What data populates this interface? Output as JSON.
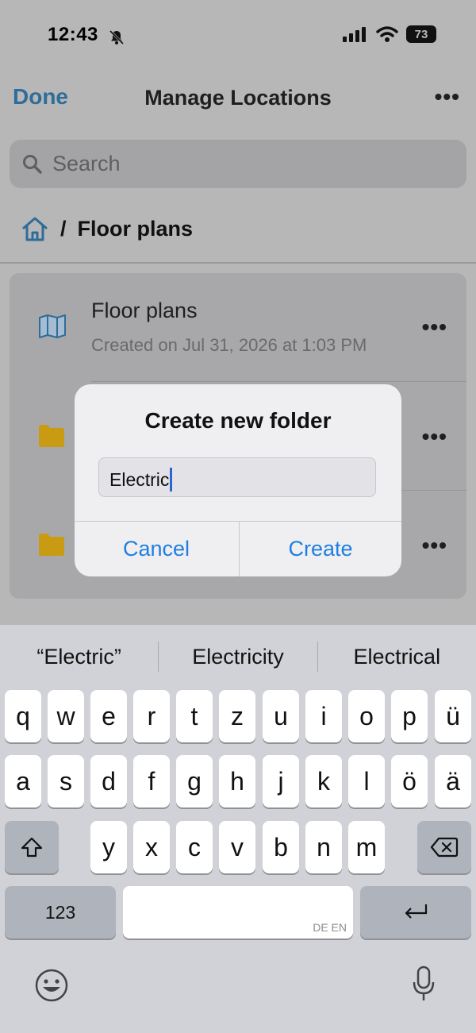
{
  "status": {
    "time": "12:43",
    "battery": "73"
  },
  "nav": {
    "done": "Done",
    "title": "Manage Locations",
    "more": "•••"
  },
  "search": {
    "placeholder": "Search"
  },
  "breadcrumb": {
    "separator": "/",
    "current": "Floor plans"
  },
  "list": {
    "items": [
      {
        "title": "Floor plans",
        "subtitle": "Created on Jul 31, 2026 at 1:03 PM",
        "icon": "map-icon"
      },
      {
        "title": "",
        "subtitle": "",
        "icon": "folder-icon"
      },
      {
        "title": "",
        "subtitle": "",
        "icon": "folder-icon"
      }
    ],
    "more": "•••"
  },
  "dialog": {
    "title": "Create new folder",
    "input_value": "Electric",
    "cancel": "Cancel",
    "create": "Create"
  },
  "keyboard": {
    "suggestions": [
      "“Electric”",
      "Electricity",
      "Electrical"
    ],
    "row1": [
      "q",
      "w",
      "e",
      "r",
      "t",
      "z",
      "u",
      "i",
      "o",
      "p",
      "ü"
    ],
    "row2": [
      "a",
      "s",
      "d",
      "f",
      "g",
      "h",
      "j",
      "k",
      "l",
      "ö",
      "ä"
    ],
    "row3": [
      "y",
      "x",
      "c",
      "v",
      "b",
      "n",
      "m"
    ],
    "numbers": "123",
    "space_lang": "DE EN"
  },
  "colors": {
    "accent": "#1f7fe0",
    "done": "#2f6d98",
    "folder": "#c99b12",
    "caret": "#2f63d6"
  }
}
